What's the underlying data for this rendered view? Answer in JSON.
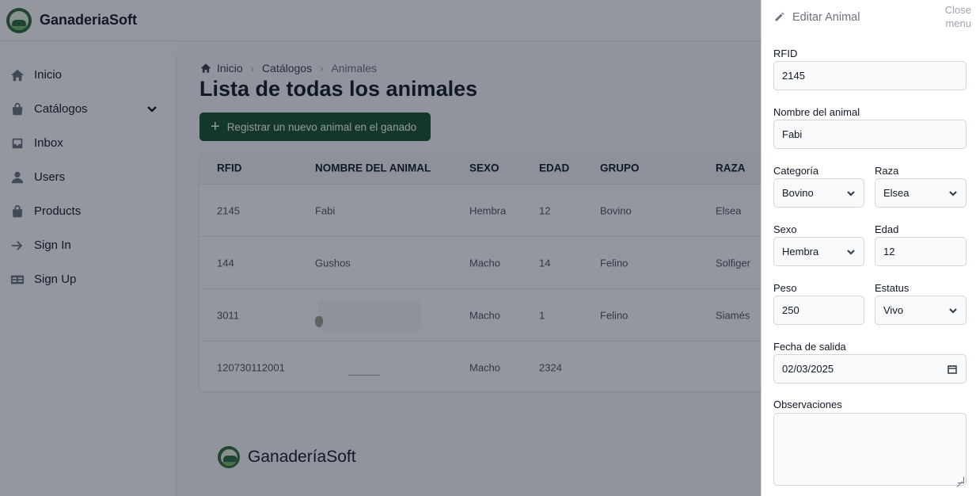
{
  "app": {
    "brand": "GanaderiaSoft",
    "footer_brand": "GanaderíaSoft"
  },
  "sidebar": {
    "items": [
      {
        "label": "Inicio",
        "icon": "home-icon"
      },
      {
        "label": "Catálogos",
        "icon": "bag-icon",
        "expandable": true
      },
      {
        "label": "Inbox",
        "icon": "inbox-icon"
      },
      {
        "label": "Users",
        "icon": "user-icon"
      },
      {
        "label": "Products",
        "icon": "bag-icon"
      },
      {
        "label": "Sign In",
        "icon": "arrow-right-icon"
      },
      {
        "label": "Sign Up",
        "icon": "id-card-icon"
      }
    ]
  },
  "breadcrumb": {
    "items": [
      "Inicio",
      "Catálogos",
      "Animales"
    ]
  },
  "page": {
    "title": "Lista de todas los animales",
    "add_button": "Registrar un nuevo animal en el ganado"
  },
  "table": {
    "headers": [
      "RFID",
      "NOMBRE DEL ANIMAL",
      "SEXO",
      "EDAD",
      "GRUPO",
      "RAZA"
    ],
    "rows": [
      [
        "2145",
        "Fabi",
        "Hembra",
        "12",
        "Bovino",
        "Elsea"
      ],
      [
        "144",
        "Gushos",
        "Macho",
        "14",
        "Felino",
        "Solfiger"
      ],
      [
        "3011",
        "",
        "Macho",
        "1",
        "Felino",
        "Siamés"
      ],
      [
        "120730112001",
        "",
        "Macho",
        "2324",
        "",
        ""
      ]
    ]
  },
  "drawer": {
    "title": "Editar Animal",
    "close_label": "Close menu",
    "fields": {
      "rfid": {
        "label": "RFID",
        "value": "2145"
      },
      "nombre": {
        "label": "Nombre del animal",
        "value": "Fabi"
      },
      "categoria": {
        "label": "Categoría",
        "value": "Bovino"
      },
      "raza": {
        "label": "Raza",
        "value": "Elsea"
      },
      "sexo": {
        "label": "Sexo",
        "value": "Hembra"
      },
      "edad": {
        "label": "Edad",
        "value": "12"
      },
      "peso": {
        "label": "Peso",
        "value": "250"
      },
      "estatus": {
        "label": "Estatus",
        "value": "Vivo"
      },
      "fecha": {
        "label": "Fecha de salida",
        "value": "02/03/2025"
      },
      "observaciones": {
        "label": "Observaciones",
        "value": ""
      }
    }
  },
  "colors": {
    "primary": "#14532d",
    "overlay": "#111827",
    "logo": "#2f6b3c"
  }
}
